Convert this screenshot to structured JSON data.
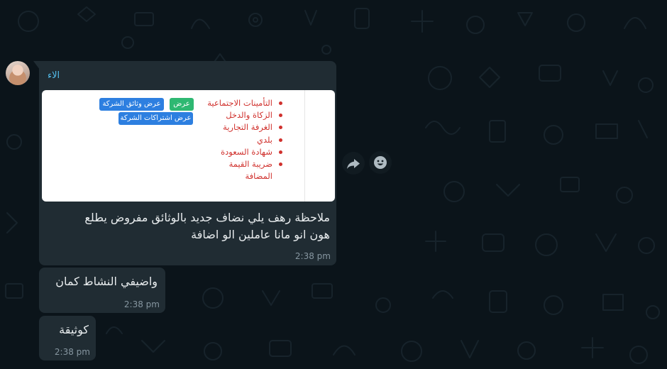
{
  "chat": {
    "messages": [
      {
        "sender": "الاء",
        "attachment": {
          "list_items": [
            "التأمينات الاجتماعية",
            "الزكاة والدخل",
            "الغرفة التجارية",
            "بلدي",
            "شهادة السعودة",
            "ضريبة القيمة",
            "المضافة"
          ],
          "buttons": {
            "view": "عرض",
            "company_docs": "عرض وثائق الشركة",
            "company_subscriptions": "عرض اشتراكات الشركة"
          }
        },
        "text_line1": "ملاحظة رهف يلي نضاف جديد بالوثائق مفروض يطلع",
        "text_line2": "هون انو مانا عاملين الو اضافة",
        "time": "2:38 pm"
      },
      {
        "text": "واضيفي النشاط كمان",
        "time": "2:38 pm"
      },
      {
        "text": "كوثيقة",
        "time": "2:38 pm"
      }
    ]
  },
  "icons": {
    "forward": "forward-icon",
    "emoji": "emoji-icon"
  },
  "colors": {
    "background": "#0b141a",
    "bubble": "#202c33",
    "sender_name": "#53bdeb",
    "list_red": "#d0312d",
    "button_green": "#2eb872",
    "button_blue": "#2d7fe0"
  }
}
